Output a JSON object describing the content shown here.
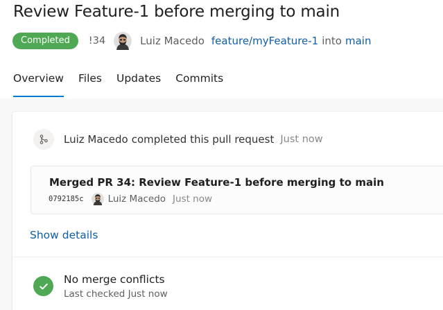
{
  "pr": {
    "title": "Review Feature-1 before merging to main",
    "status": "Completed",
    "id": "!34",
    "author": "Luiz Macedo",
    "source_branch": "feature/myFeature-1",
    "into_text": "into",
    "target_branch": "main",
    "status_color": "#4fa853"
  },
  "tabs": [
    {
      "label": "Overview",
      "active": true
    },
    {
      "label": "Files",
      "active": false
    },
    {
      "label": "Updates",
      "active": false
    },
    {
      "label": "Commits",
      "active": false
    }
  ],
  "activity": {
    "icon": "merge-branch-icon",
    "author": "Luiz Macedo",
    "action": "completed this pull request",
    "time": "Just now"
  },
  "commit": {
    "message": "Merged PR 34: Review Feature-1 before merging to main",
    "hash": "0792185c",
    "author": "Luiz Macedo",
    "time": "Just now"
  },
  "show_details": "Show details",
  "merge_status": {
    "icon": "checkmark-icon",
    "title": "No merge conflicts",
    "subtitle": "Last checked Just now"
  },
  "colors": {
    "link": "#0f5ea8",
    "tab_underline": "#0078d4",
    "success": "#4fa853"
  }
}
